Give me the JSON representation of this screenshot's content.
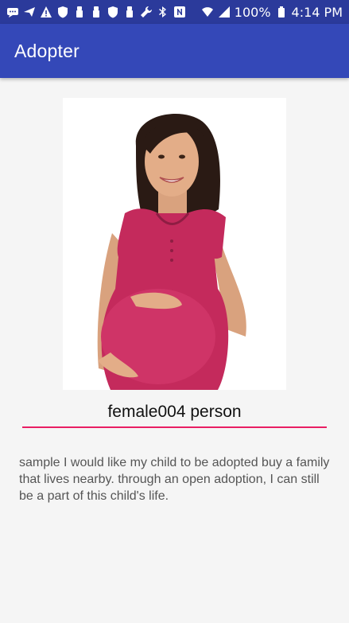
{
  "status_bar": {
    "battery": "100%",
    "time": "4:14 PM",
    "icons": [
      "message-icon",
      "send-icon",
      "alert-icon",
      "shield-icon",
      "usb-icon",
      "usb-icon",
      "shield-icon",
      "usb-icon",
      "wrench-icon",
      "bluetooth-icon",
      "nfc-icon",
      "wifi-icon",
      "signal-icon",
      "battery-icon"
    ]
  },
  "app_bar": {
    "title": "Adopter"
  },
  "profile": {
    "photo_icon": "person-photo",
    "name": "female004 person",
    "description": "sample I would like my child to be adopted buy a family that lives nearby. through an open adoption, I can still be a part of this child's life."
  },
  "colors": {
    "status_bar": "#2b3a9b",
    "app_bar": "#3448b8",
    "accent_underline": "#e91e63",
    "background": "#f5f5f5"
  }
}
